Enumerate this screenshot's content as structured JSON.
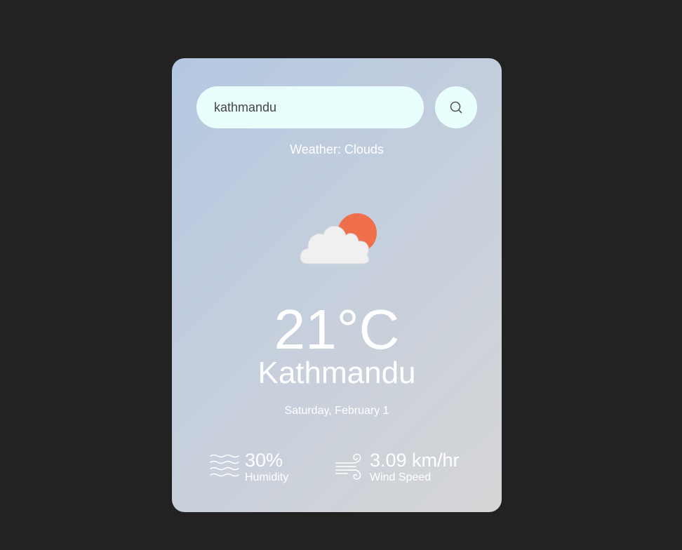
{
  "search": {
    "value": "kathmandu",
    "icon": "search-icon"
  },
  "weather": {
    "description": "Weather: Clouds",
    "icon": "cloud-sun-icon",
    "temperature": "21°C",
    "city": "Kathmandu",
    "date": "Saturday, February 1"
  },
  "stats": {
    "humidity": {
      "value": "30%",
      "label": "Humidity",
      "icon": "humidity-waves-icon"
    },
    "wind": {
      "value": "3.09 km/hr",
      "label": "Wind Speed",
      "icon": "wind-icon"
    }
  },
  "colors": {
    "page_background": "#222222",
    "input_background": "#e8fffd",
    "sun": "#ef6f4b",
    "cloud": "#f2f2f2"
  }
}
